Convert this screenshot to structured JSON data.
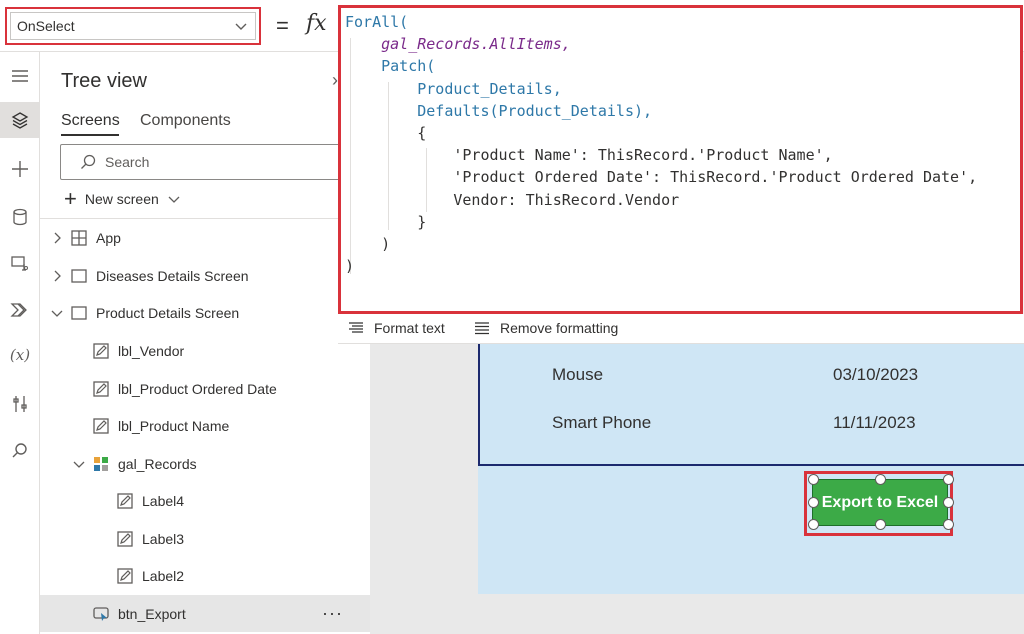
{
  "formula_bar": {
    "property": "OnSelect",
    "equals": "=",
    "fx": "fx"
  },
  "formula": {
    "lines": [
      "ForAll(",
      "    gal_Records.AllItems,",
      "    Patch(",
      "        Product_Details,",
      "        Defaults(Product_Details),",
      "        {",
      "            'Product Name': ThisRecord.'Product Name',",
      "            'Product Ordered Date': ThisRecord.'Product Ordered Date',",
      "            Vendor: ThisRecord.Vendor",
      "        }",
      "    )",
      ")"
    ]
  },
  "format_bar": {
    "format_text": "Format text",
    "remove_formatting": "Remove formatting"
  },
  "tree_view": {
    "title": "Tree view",
    "tabs": {
      "screens": "Screens",
      "components": "Components"
    },
    "search_placeholder": "Search",
    "new_screen": "New screen",
    "nodes": [
      {
        "label": "App"
      },
      {
        "label": "Diseases Details Screen"
      },
      {
        "label": "Product Details Screen"
      },
      {
        "label": "lbl_Vendor"
      },
      {
        "label": "lbl_Product Ordered Date"
      },
      {
        "label": "lbl_Product Name"
      },
      {
        "label": "gal_Records"
      },
      {
        "label": "Label4"
      },
      {
        "label": "Label3"
      },
      {
        "label": "Label2"
      },
      {
        "label": "btn_Export",
        "selected": true,
        "more": "···"
      }
    ]
  },
  "canvas": {
    "rows": [
      {
        "name": "Mouse",
        "date": "03/10/2023"
      },
      {
        "name": "Smart Phone",
        "date": "11/11/2023"
      }
    ],
    "export_button": "Export to Excel"
  },
  "colors": {
    "highlight_red": "#d9323b",
    "button_green": "#3caa47",
    "screen_blue": "#cfe6f5",
    "gallery_border": "#1c2a6e"
  }
}
